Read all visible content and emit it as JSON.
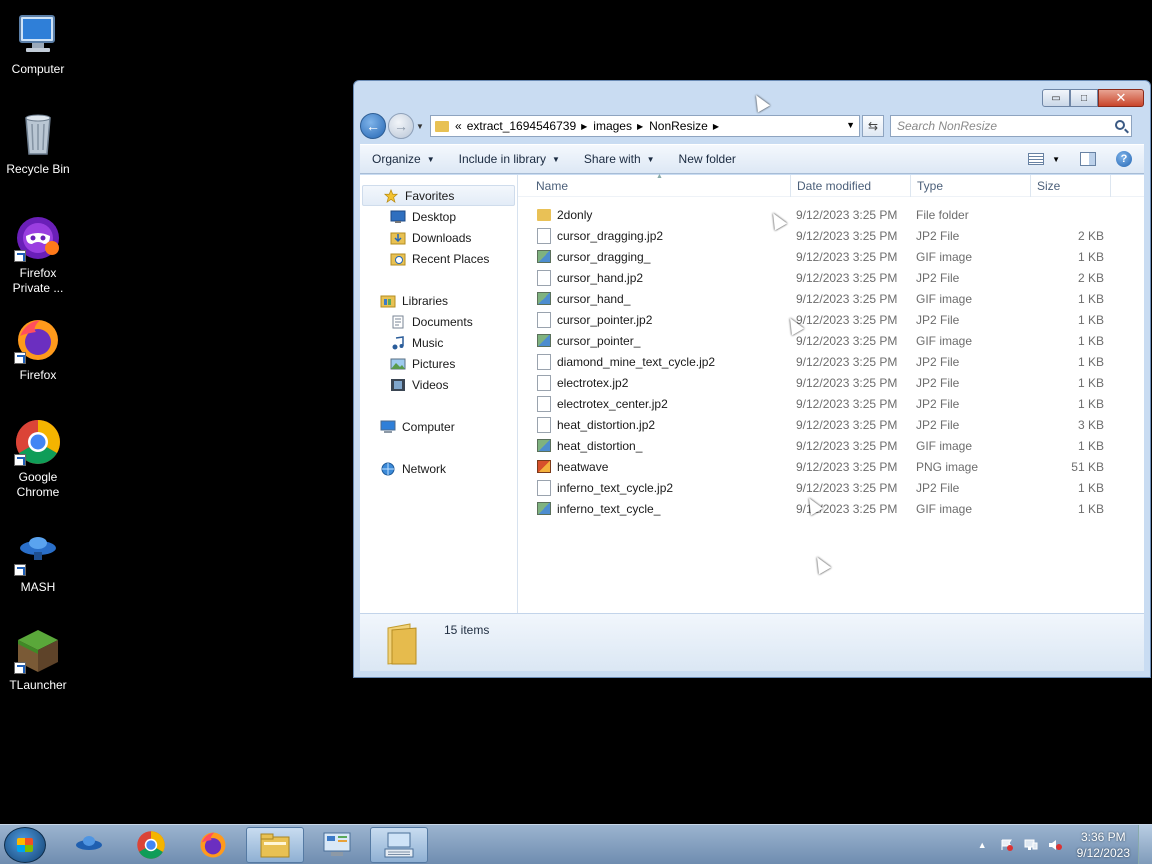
{
  "desktop": {
    "icons": [
      {
        "label": "Computer"
      },
      {
        "label": "Recycle Bin"
      },
      {
        "label": "Firefox Private ..."
      },
      {
        "label": "Firefox"
      },
      {
        "label": "Google Chrome"
      },
      {
        "label": "MASH"
      },
      {
        "label": "TLauncher"
      }
    ]
  },
  "window": {
    "buttons": {
      "minimize": "▭",
      "maximize": "□",
      "close": "✕"
    },
    "nav": {
      "back": "←",
      "forward": "→"
    },
    "address": {
      "overflow": "«",
      "crumbs": [
        "extract_1694546739",
        "images",
        "NonResize"
      ],
      "separator": "▶"
    },
    "refresh": "⇆",
    "search": {
      "placeholder": "Search NonResize"
    },
    "commands": [
      {
        "label": "Organize"
      },
      {
        "label": "Include in library"
      },
      {
        "label": "Share with"
      },
      {
        "label": "New folder"
      }
    ],
    "dropdown_arrow": "▼",
    "help": "?",
    "nav_pane": {
      "favorites": {
        "label": "Favorites",
        "items": [
          "Desktop",
          "Downloads",
          "Recent Places"
        ]
      },
      "libraries": {
        "label": "Libraries",
        "items": [
          "Documents",
          "Music",
          "Pictures",
          "Videos"
        ]
      },
      "computer": "Computer",
      "network": "Network"
    },
    "columns": {
      "name": "Name",
      "date": "Date modified",
      "type": "Type",
      "size": "Size"
    },
    "files": [
      {
        "name": "2donly",
        "date": "9/12/2023 3:25 PM",
        "type": "File folder",
        "size": "",
        "icon": "folder"
      },
      {
        "name": "cursor_dragging.jp2",
        "date": "9/12/2023 3:25 PM",
        "type": "JP2 File",
        "size": "2 KB",
        "icon": "doc"
      },
      {
        "name": "cursor_dragging_",
        "date": "9/12/2023 3:25 PM",
        "type": "GIF image",
        "size": "1 KB",
        "icon": "gif"
      },
      {
        "name": "cursor_hand.jp2",
        "date": "9/12/2023 3:25 PM",
        "type": "JP2 File",
        "size": "2 KB",
        "icon": "doc"
      },
      {
        "name": "cursor_hand_",
        "date": "9/12/2023 3:25 PM",
        "type": "GIF image",
        "size": "1 KB",
        "icon": "gif"
      },
      {
        "name": "cursor_pointer.jp2",
        "date": "9/12/2023 3:25 PM",
        "type": "JP2 File",
        "size": "1 KB",
        "icon": "doc"
      },
      {
        "name": "cursor_pointer_",
        "date": "9/12/2023 3:25 PM",
        "type": "GIF image",
        "size": "1 KB",
        "icon": "gif"
      },
      {
        "name": "diamond_mine_text_cycle.jp2",
        "date": "9/12/2023 3:25 PM",
        "type": "JP2 File",
        "size": "1 KB",
        "icon": "doc"
      },
      {
        "name": "electrotex.jp2",
        "date": "9/12/2023 3:25 PM",
        "type": "JP2 File",
        "size": "1 KB",
        "icon": "doc"
      },
      {
        "name": "electrotex_center.jp2",
        "date": "9/12/2023 3:25 PM",
        "type": "JP2 File",
        "size": "1 KB",
        "icon": "doc"
      },
      {
        "name": "heat_distortion.jp2",
        "date": "9/12/2023 3:25 PM",
        "type": "JP2 File",
        "size": "3 KB",
        "icon": "doc"
      },
      {
        "name": "heat_distortion_",
        "date": "9/12/2023 3:25 PM",
        "type": "GIF image",
        "size": "1 KB",
        "icon": "gif"
      },
      {
        "name": "heatwave",
        "date": "9/12/2023 3:25 PM",
        "type": "PNG image",
        "size": "51 KB",
        "icon": "png"
      },
      {
        "name": "inferno_text_cycle.jp2",
        "date": "9/12/2023 3:25 PM",
        "type": "JP2 File",
        "size": "1 KB",
        "icon": "doc"
      },
      {
        "name": "inferno_text_cycle_",
        "date": "9/12/2023 3:25 PM",
        "type": "GIF image",
        "size": "1 KB",
        "icon": "gif"
      }
    ],
    "details": {
      "count": "15 items"
    }
  },
  "taskbar": {
    "clock": {
      "time": "3:36 PM",
      "date": "9/12/2023"
    },
    "tray_expand": "▲"
  }
}
